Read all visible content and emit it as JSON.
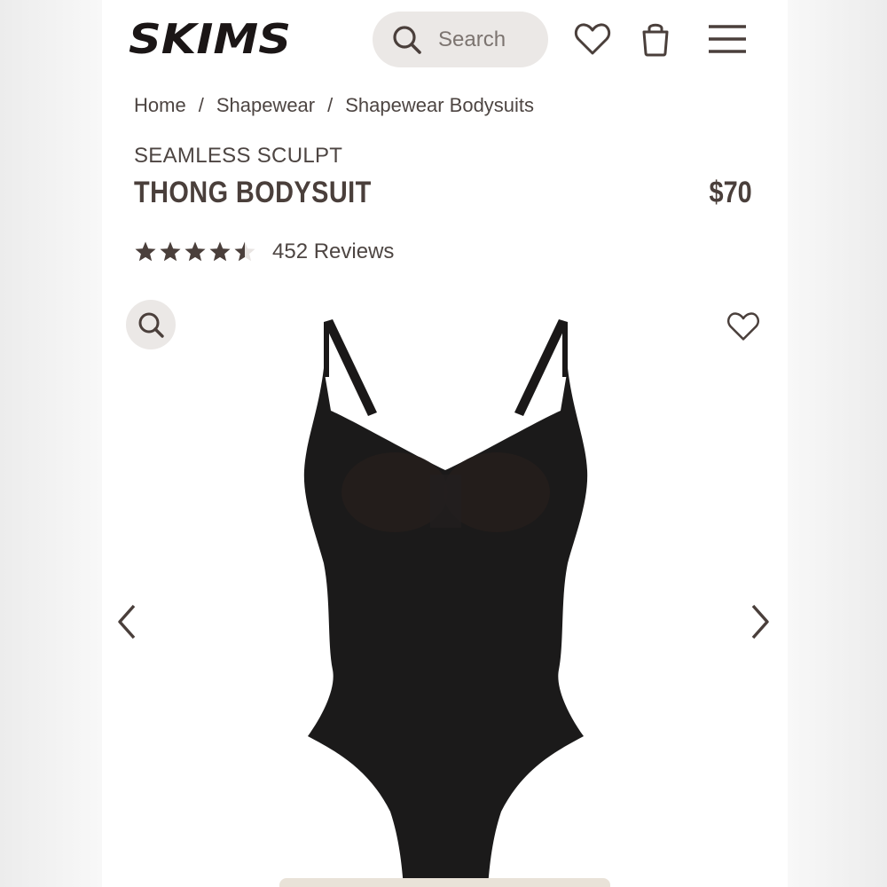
{
  "header": {
    "logo_text": "SKIMS",
    "search_placeholder": "Search",
    "icons": [
      "search-icon",
      "heart-icon",
      "shopping-bag-icon",
      "menu-icon"
    ]
  },
  "breadcrumb": [
    "Home",
    "Shapewear",
    "Shapewear Bodysuits"
  ],
  "breadcrumb_separator": "/",
  "product": {
    "collection": "SEAMLESS SCULPT",
    "name": "THONG BODYSUIT",
    "price": "$70",
    "rating": 4.5,
    "rating_max": 5,
    "reviews": "452 Reviews"
  },
  "gallery": {
    "icons": [
      "zoom-icon",
      "heart-icon",
      "chevron-left-icon",
      "chevron-right-icon"
    ]
  },
  "colors": {
    "text": "#4a3f3b",
    "pill": "#ebe8e6",
    "product": "#1a1a1a",
    "star": "#4a3f3b"
  }
}
